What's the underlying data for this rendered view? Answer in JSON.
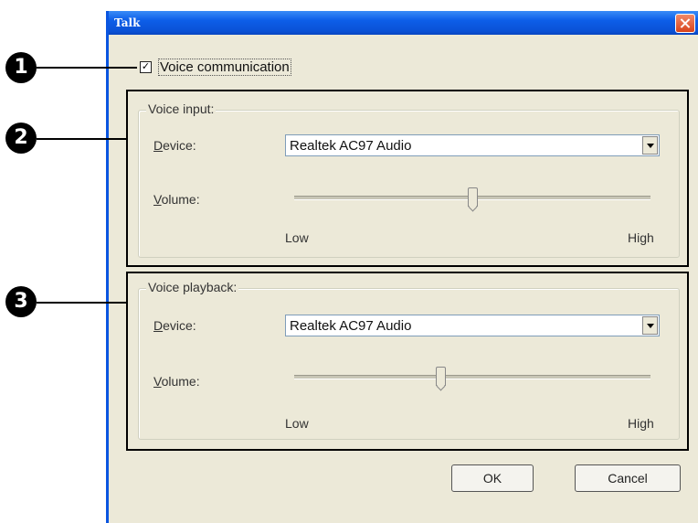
{
  "window": {
    "title": "Talk"
  },
  "voice_communication": {
    "label": "Voice communication",
    "checked": true
  },
  "voice_input": {
    "legend": "Voice input:",
    "device_label_underline": "D",
    "device_label_rest": "evice:",
    "device_value": "Realtek AC97 Audio",
    "volume_label_underline": "V",
    "volume_label_rest": "olume:",
    "low_label": "Low",
    "high_label": "High",
    "volume_level": 0.5
  },
  "voice_playback": {
    "legend": "Voice playback:",
    "device_label_underline": "D",
    "device_label_rest": "evice:",
    "device_value": "Realtek AC97 Audio",
    "volume_label_underline": "V",
    "volume_label_rest": "olume:",
    "low_label": "Low",
    "high_label": "High",
    "volume_level": 0.41
  },
  "buttons": {
    "ok": "OK",
    "cancel": "Cancel"
  },
  "callouts": [
    "1",
    "2",
    "3"
  ]
}
